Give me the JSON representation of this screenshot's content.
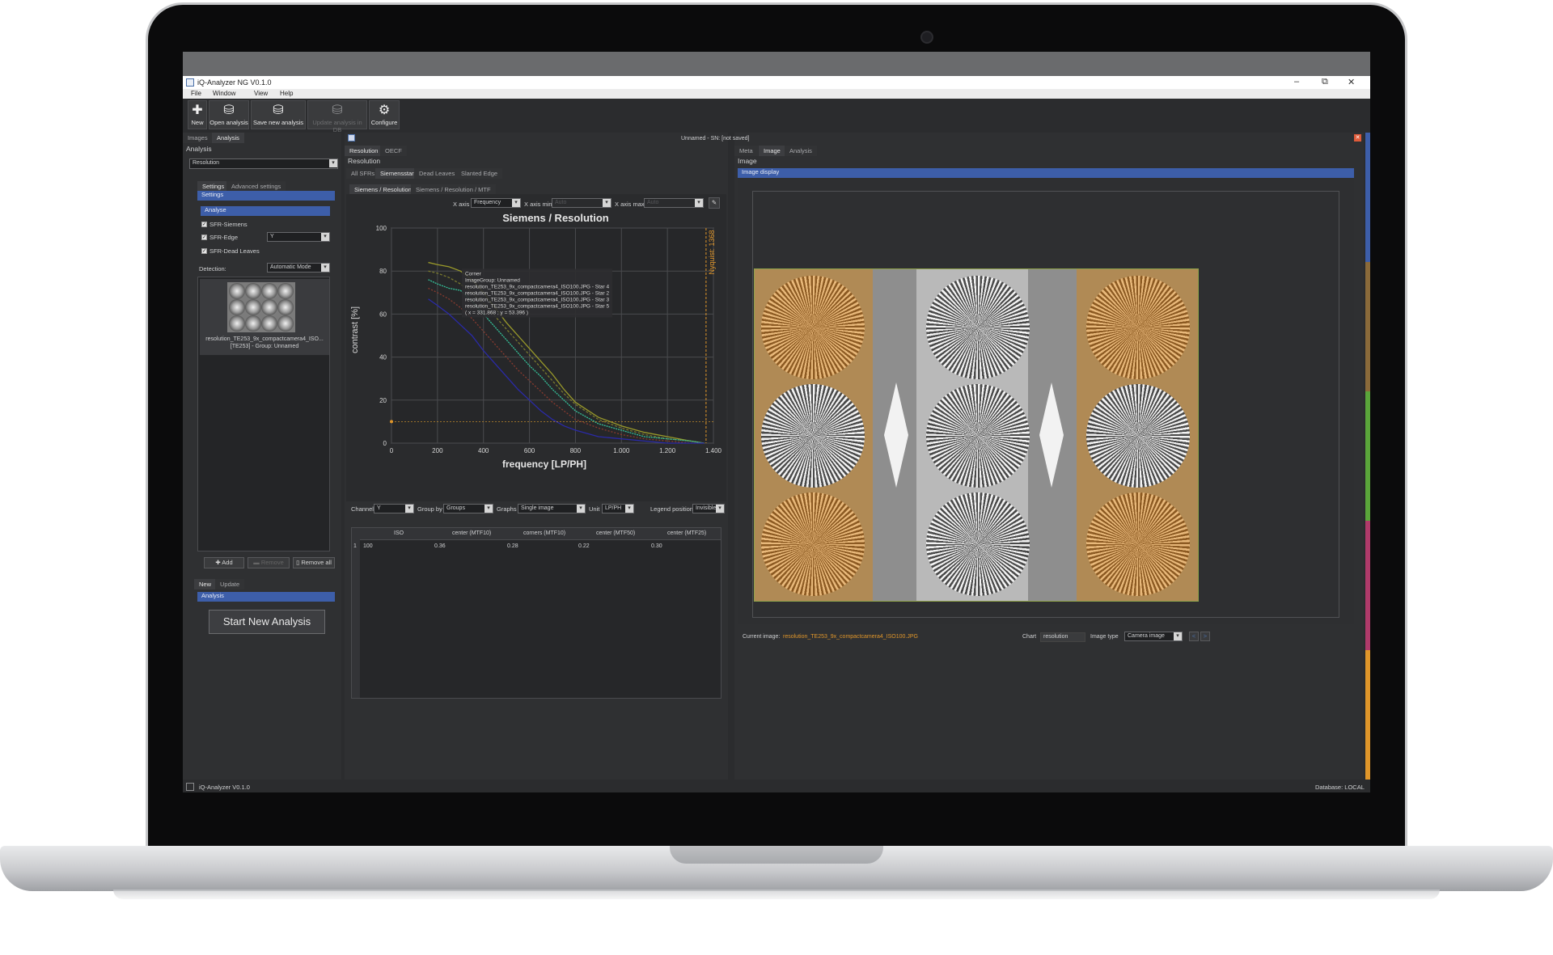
{
  "window": {
    "title": "iQ-Analyzer NG V0.1.0",
    "minimize": "–",
    "maximize": "⧉",
    "close": "✕"
  },
  "menu": [
    "File",
    "Window",
    "View",
    "Help"
  ],
  "toolbar": [
    {
      "icon": "plus-icon",
      "glyph": "✚",
      "label": "New",
      "enabled": true
    },
    {
      "icon": "open-icon",
      "glyph": "⛁",
      "label": "Open analysis",
      "enabled": true
    },
    {
      "icon": "save-icon",
      "glyph": "⛁",
      "label": "Save new analysis",
      "enabled": true
    },
    {
      "icon": "update-icon",
      "glyph": "⛁",
      "label": "Update analysis in DB",
      "enabled": false
    },
    {
      "icon": "gear-icon",
      "glyph": "⚙",
      "label": "Configure",
      "enabled": true
    }
  ],
  "left": {
    "tabs": [
      "Images",
      "Analysis"
    ],
    "section_title": "Analysis",
    "analysis_select": "Resolution",
    "settings_tabs": [
      "Settings",
      "Advanced settings"
    ],
    "settings_header": "Settings",
    "analyse_header": "Analyse",
    "checks": [
      {
        "label": "SFR-Siemens",
        "checked": true
      },
      {
        "label": "SFR-Edge",
        "checked": true
      },
      {
        "label": "SFR-Dead Leaves",
        "checked": true
      }
    ],
    "edge_channel": "Y",
    "detection_label": "Detection:",
    "detection_value": "Automatic Mode",
    "thumb_caption_1": "resolution_TE253_9x_compactcamera4_ISO...",
    "thumb_caption_2": "[TE253] - Group: Unnamed",
    "add_label": "Add",
    "remove_label": "Remove",
    "remove_all_label": "Remove all",
    "bottom_tabs": [
      "New",
      "Update"
    ],
    "bottom_header": "Analysis",
    "start_button": "Start New Analysis"
  },
  "center": {
    "status": "Unnamed - SN: [not saved]",
    "tabs": [
      "Resolution",
      "OECF"
    ],
    "section_title": "Resolution",
    "sub_tabs": [
      "All SFRs",
      "Siemensstar",
      "Dead Leaves",
      "Slanted Edge"
    ],
    "view_tabs": [
      "Siemens / Resolution",
      "Siemens / Resolution / MTF"
    ],
    "xaxis_label": "X axis",
    "xaxis_value": "Frequency",
    "xmin_label": "X axis min",
    "xmin_value": "Auto",
    "xmax_label": "X axis max",
    "xmax_value": "Auto",
    "channel_label": "Channel",
    "channel_value": "Y",
    "groupby_label": "Group by",
    "groupby_value": "Groups",
    "graphs_label": "Graphs",
    "graphs_value": "Single image",
    "unit_label": "Unit",
    "unit_value": "LP/PH",
    "legend_label": "Legend position",
    "legend_value": "Invisible",
    "table": {
      "headers": [
        "ISO",
        "center (MTF10)",
        "corners (MTF10)",
        "center (MTF50)",
        "center (MTF25)"
      ],
      "rows": [
        {
          "index": "1",
          "cells": [
            "100",
            "0.36",
            "0.28",
            "0.22",
            "0.30"
          ]
        }
      ]
    }
  },
  "chart_data": {
    "type": "line",
    "title": "Siemens / Resolution",
    "xlabel": "frequency [LP/PH]",
    "ylabel": "contrast [%]",
    "xlim": [
      0,
      1400
    ],
    "ylim": [
      0,
      100
    ],
    "xticks": [
      0,
      200,
      400,
      600,
      800,
      1000,
      1200,
      1400
    ],
    "xtick_labels": [
      "0",
      "200",
      "400",
      "600",
      "800",
      "1.000",
      "1.200",
      "1.400"
    ],
    "yticks": [
      0,
      20,
      40,
      60,
      80,
      100
    ],
    "grid": true,
    "nyquist": {
      "x": 1368,
      "label": "Nyquist: 1368"
    },
    "crosshair": {
      "x": 0,
      "y": 10
    },
    "tooltip": [
      "Corner",
      "ImageGroup: Unnamed",
      "resolution_TE253_9x_compactcamera4_ISO100.JPG - Star 4",
      "resolution_TE253_9x_compactcamera4_ISO100.JPG - Star 2",
      "resolution_TE253_9x_compactcamera4_ISO100.JPG - Star 3",
      "resolution_TE253_9x_compactcamera4_ISO100.JPG - Star 5",
      "( x = 331.868 ; y = 53.396 )"
    ],
    "series": [
      {
        "color": "#9a9a2a",
        "dash": "",
        "x": [
          160,
          200,
          250,
          300,
          350,
          400,
          450,
          500,
          550,
          600,
          650,
          700,
          750,
          800,
          900,
          1000,
          1100,
          1200,
          1300,
          1360
        ],
        "values": [
          84,
          83,
          82,
          80,
          76,
          70,
          63,
          56,
          50,
          44,
          38,
          32,
          25,
          19,
          12,
          8,
          5,
          3,
          1,
          0
        ]
      },
      {
        "color": "#7a7a2e",
        "dash": "3,2",
        "x": [
          160,
          200,
          250,
          300,
          350,
          400,
          450,
          500,
          550,
          600,
          650,
          700,
          750,
          800,
          900,
          1000,
          1100,
          1200,
          1300,
          1360
        ],
        "values": [
          80,
          79,
          77,
          74,
          70,
          65,
          59,
          53,
          47,
          41,
          35,
          29,
          23,
          18,
          11,
          7,
          4,
          2,
          1,
          0
        ]
      },
      {
        "color": "#35c29a",
        "dash": "2,1",
        "x": [
          160,
          200,
          250,
          300,
          350,
          400,
          450,
          500,
          550,
          600,
          650,
          700,
          750,
          800,
          900,
          1000,
          1100,
          1200,
          1300,
          1360
        ],
        "values": [
          76,
          74,
          72,
          71,
          66,
          60,
          54,
          48,
          42,
          36,
          31,
          25,
          20,
          15,
          9,
          6,
          3,
          2,
          1,
          0
        ]
      },
      {
        "color": "#8a3b2f",
        "dash": "2,2",
        "x": [
          160,
          200,
          250,
          300,
          350,
          400,
          450,
          500,
          550,
          600,
          650,
          700,
          750,
          800,
          900,
          1000,
          1100,
          1200,
          1300,
          1360
        ],
        "values": [
          72,
          70,
          67,
          63,
          58,
          52,
          46,
          40,
          34,
          29,
          24,
          19,
          15,
          11,
          7,
          4,
          2,
          1,
          0,
          0
        ]
      },
      {
        "color": "#2a2aa8",
        "dash": "",
        "x": [
          160,
          200,
          250,
          300,
          350,
          400,
          450,
          500,
          550,
          600,
          650,
          700,
          750,
          800,
          900,
          1000,
          1100,
          1200,
          1300,
          1360
        ],
        "values": [
          67,
          64,
          60,
          55,
          50,
          43,
          37,
          31,
          25,
          20,
          15,
          11,
          8,
          6,
          3,
          2,
          1,
          0,
          0,
          0
        ]
      }
    ]
  },
  "right": {
    "tabs": [
      "Meta",
      "Image",
      "Analysis"
    ],
    "section_title": "Image",
    "header": "Image display",
    "current_image_label": "Current image:",
    "current_image_value": "resolution_TE253_9x_compactcamera4_ISO100.JPG",
    "chart_label": "Chart",
    "chart_value": "resolution",
    "image_type_label": "Image type",
    "image_type_value": "Camera image",
    "prev": "<",
    "next": ">"
  },
  "statusbar": {
    "left": "iQ-Analyzer V0.1.0",
    "right": "Database: LOCAL"
  },
  "colors": {
    "accent_blue": "#3d5ea9",
    "orange": "#e0962a",
    "stripe": [
      "#3d5ea9",
      "#8a6a3a",
      "#5aa53a",
      "#b03a6a",
      "#e0962a"
    ]
  }
}
